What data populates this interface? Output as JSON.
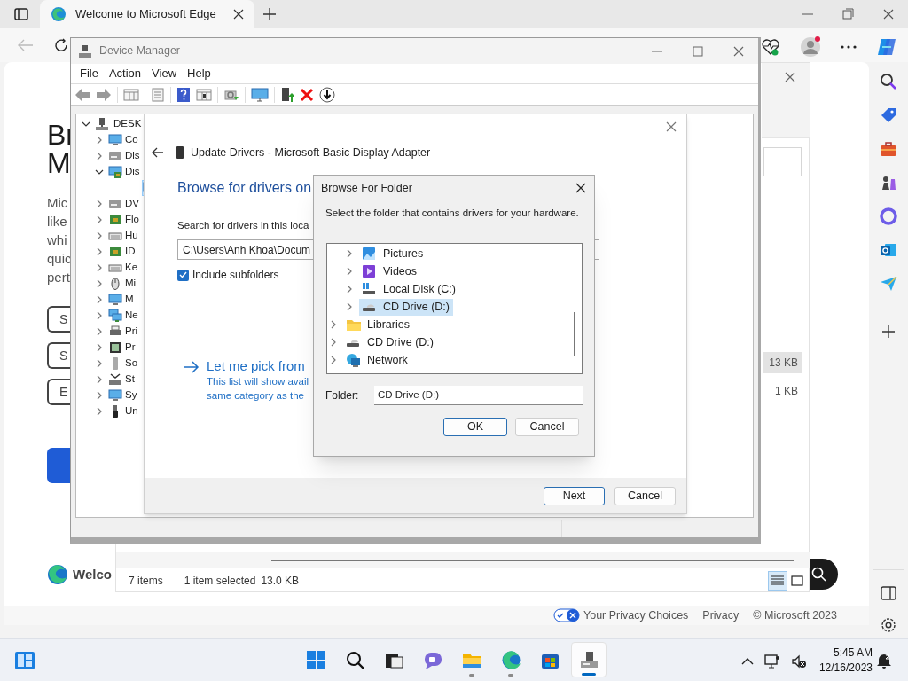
{
  "browser": {
    "tab": {
      "title": "Welcome to Microsoft Edge",
      "selected": true
    }
  },
  "edge_page": {
    "heading": [
      "Br",
      "M"
    ],
    "paragraph": [
      "Mic",
      "like",
      "whi",
      "quic",
      "pert"
    ],
    "buttons": [
      "S",
      "S",
      "E"
    ],
    "brand": "Welco",
    "footer": {
      "privacy_choices": "Your Privacy Choices",
      "privacy": "Privacy",
      "copyright": "© Microsoft 2023"
    }
  },
  "explorer": {
    "sizes": [
      {
        "text": "13 KB",
        "selected": true
      },
      {
        "text": "1 KB",
        "selected": false
      }
    ],
    "status": {
      "count": "7 items",
      "selection": "1 item selected",
      "size": "13.0 KB"
    },
    "views": [
      {
        "kind": "details",
        "selected": true
      },
      {
        "kind": "tiles",
        "selected": false
      }
    ]
  },
  "device_manager": {
    "title": "Device Manager",
    "menu": [
      "File",
      "Action",
      "View",
      "Help"
    ],
    "tree": {
      "label": "DESK",
      "kind": "pc",
      "expanded": true,
      "children": [
        {
          "label": "Co",
          "kind": "monitor",
          "expanded": false
        },
        {
          "label": "Dis",
          "kind": "drive",
          "expanded": false
        },
        {
          "label": "Dis",
          "kind": "display",
          "expanded": true,
          "children": [
            {
              "kind": "display",
              "selected": true
            }
          ]
        },
        {
          "label": "DV",
          "kind": "drive",
          "expanded": false
        },
        {
          "label": "Flo",
          "kind": "board",
          "expanded": false
        },
        {
          "label": "Hu",
          "kind": "keyboard",
          "expanded": false
        },
        {
          "label": "ID",
          "kind": "board",
          "expanded": false
        },
        {
          "label": "Ke",
          "kind": "keyboard",
          "expanded": false
        },
        {
          "label": "Mi",
          "kind": "mouse",
          "expanded": false
        },
        {
          "label": "M",
          "kind": "monitor",
          "expanded": false
        },
        {
          "label": "Ne",
          "kind": "network",
          "expanded": false
        },
        {
          "label": "Pri",
          "kind": "printer",
          "expanded": false
        },
        {
          "label": "Pr",
          "kind": "chip",
          "expanded": false
        },
        {
          "label": "So",
          "kind": "software",
          "expanded": false
        },
        {
          "label": "St",
          "kind": "storage",
          "expanded": false
        },
        {
          "label": "Sy",
          "kind": "monitor",
          "expanded": false
        },
        {
          "label": "Un",
          "kind": "usb",
          "expanded": false
        }
      ]
    }
  },
  "update_drivers": {
    "title": "Update Drivers - Microsoft Basic Display Adapter",
    "heading": "Browse for drivers on",
    "search_label": "Search for drivers in this loca",
    "path": "C:\\Users\\Anh Khoa\\Docum",
    "include_subfolders": {
      "label": "Include subfolders",
      "checked": true
    },
    "pick_link": "Let me pick from",
    "pick_description": [
      "This list will show avail",
      "same category as the"
    ],
    "buttons": [
      {
        "label": "Next",
        "default": true
      },
      {
        "label": "Cancel",
        "default": false
      }
    ]
  },
  "browse_for_folder": {
    "title": "Browse For Folder",
    "instruction": "Select the folder that contains drivers for your hardware.",
    "tree": [
      {
        "children": [
          {
            "label": "Pictures",
            "kind": "pictures",
            "selected": false
          },
          {
            "label": "Videos",
            "kind": "videos",
            "selected": false
          },
          {
            "label": "Local Disk (C:)",
            "kind": "disk",
            "selected": false
          },
          {
            "label": "CD Drive (D:)",
            "kind": "cd",
            "selected": true
          }
        ]
      },
      {
        "label": "Libraries",
        "kind": "libraries",
        "selected": false
      },
      {
        "label": "CD Drive (D:)",
        "kind": "cd",
        "selected": false
      },
      {
        "label": "Network",
        "kind": "network",
        "selected": false
      }
    ],
    "folder_label": "Folder:",
    "folder_value": "CD Drive (D:)",
    "buttons": [
      {
        "label": "OK",
        "default": true
      },
      {
        "label": "Cancel",
        "default": false
      }
    ]
  },
  "taskbar": {
    "apps": [
      {
        "kind": "start",
        "open": false,
        "selected": false
      },
      {
        "kind": "search",
        "open": false,
        "selected": false
      },
      {
        "kind": "task-view",
        "open": false,
        "selected": false
      },
      {
        "kind": "chat",
        "open": false,
        "selected": false
      },
      {
        "kind": "explorer",
        "open": true,
        "selected": false
      },
      {
        "kind": "edge",
        "open": true,
        "selected": false
      },
      {
        "kind": "store",
        "open": false,
        "selected": false
      },
      {
        "kind": "device-manager",
        "open": true,
        "selected": true
      }
    ],
    "time": "5:45 AM",
    "date": "12/16/2023"
  }
}
